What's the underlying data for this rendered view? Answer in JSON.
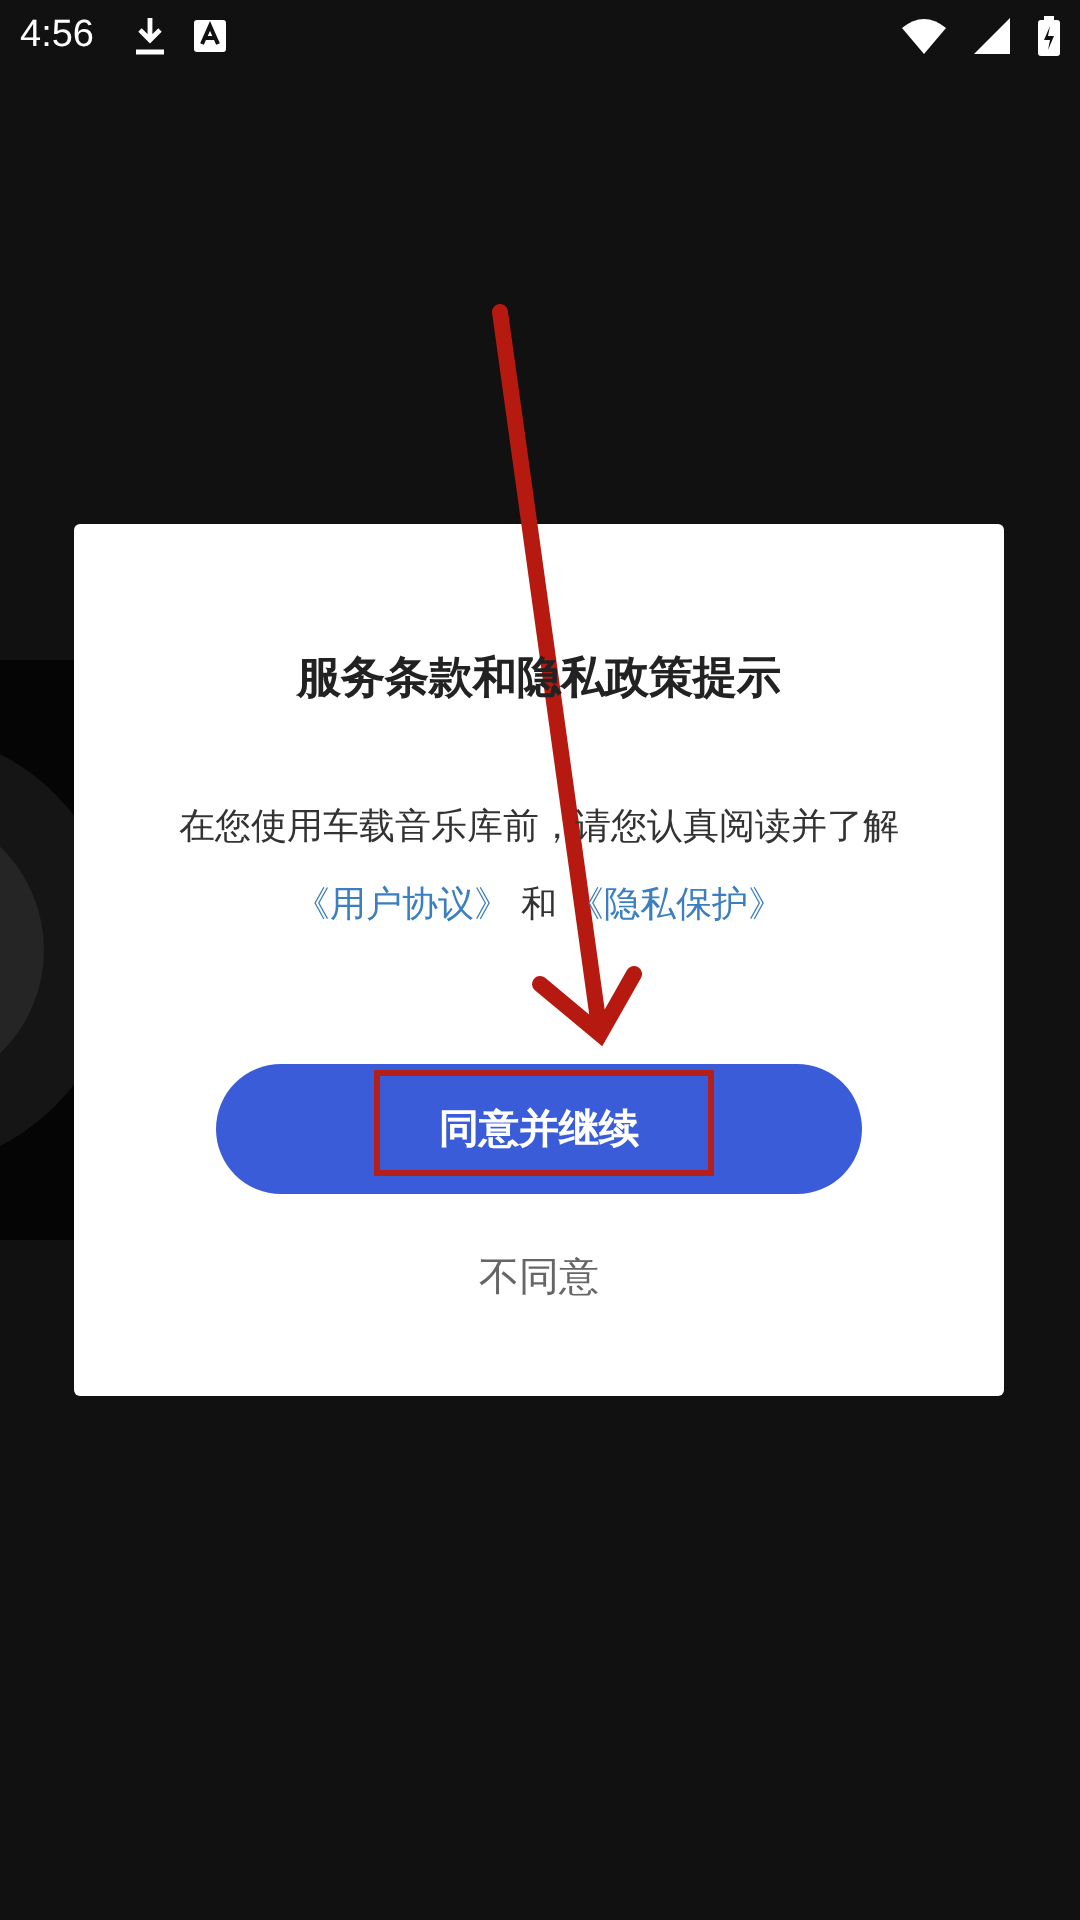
{
  "status_bar": {
    "time": "4:56"
  },
  "dialog": {
    "title": "服务条款和隐私政策提示",
    "message": "在您使用车载音乐库前，请您认真阅读并了解",
    "links": [
      {
        "label": "《用户协议》"
      },
      {
        "label": "《隐私保护》"
      }
    ],
    "connector": "和",
    "primary_button": "同意并继续",
    "secondary_button": "不同意"
  }
}
